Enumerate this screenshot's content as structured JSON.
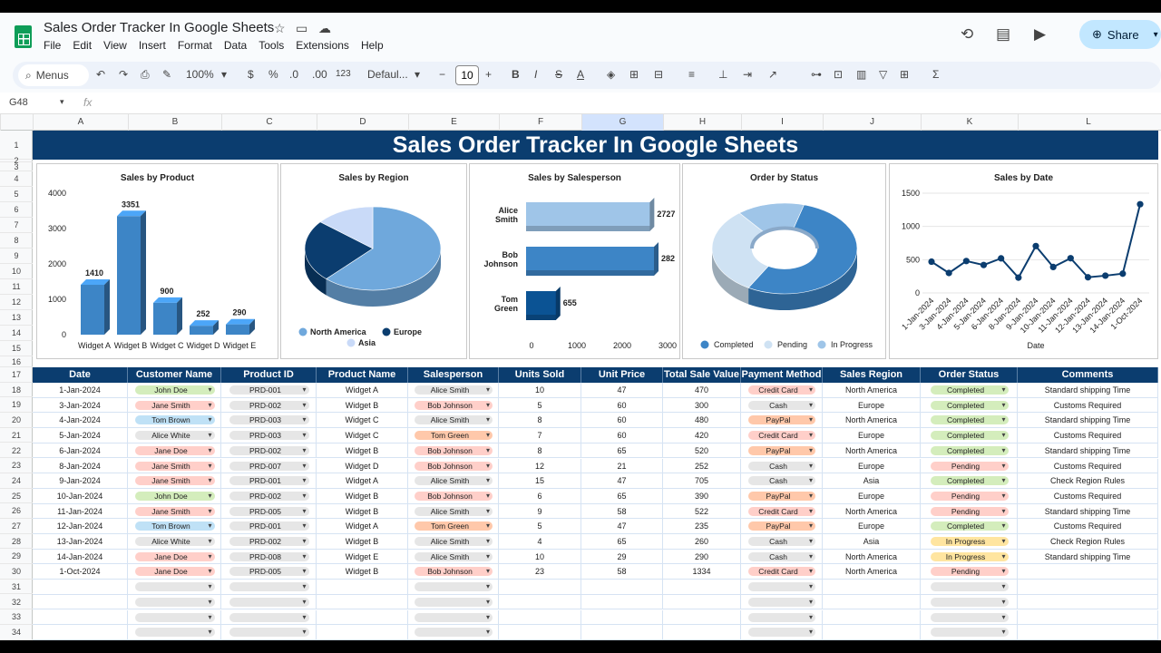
{
  "app": {
    "title": "Sales Order Tracker In Google Sheets",
    "menu": [
      "File",
      "Edit",
      "View",
      "Insert",
      "Format",
      "Data",
      "Tools",
      "Extensions",
      "Help"
    ],
    "share_label": "Share"
  },
  "toolbar": {
    "search_label": "Menus",
    "zoom": "100%",
    "currency": "$",
    "percent": "%",
    "number_format": "123",
    "font": "Defaul...",
    "font_size": "10"
  },
  "formula_bar": {
    "cell_ref": "G48",
    "fx": "fx"
  },
  "columns": [
    "A",
    "B",
    "C",
    "D",
    "E",
    "F",
    "G",
    "H",
    "I",
    "J",
    "K",
    "L"
  ],
  "banner": "Sales Order Tracker In Google Sheets",
  "charts": {
    "product": {
      "title": "Sales by Product"
    },
    "region": {
      "title": "Sales by Region"
    },
    "salesperson": {
      "title": "Sales by Salesperson"
    },
    "status": {
      "title": "Order by Status"
    },
    "date": {
      "title": "Sales by Date"
    }
  },
  "chart_data": [
    {
      "type": "bar",
      "title": "Sales by Product",
      "categories": [
        "Widget A",
        "Widget B",
        "Widget C",
        "Widget D",
        "Widget E"
      ],
      "values": [
        1410,
        3351,
        900,
        252,
        290
      ],
      "ylim": [
        0,
        4000
      ],
      "yticks": [
        "0",
        "1000",
        "2000",
        "3000",
        "4000"
      ],
      "color": "#3d85c6"
    },
    {
      "type": "pie",
      "title": "Sales by Region",
      "labels": [
        "North America",
        "Europe",
        "Asia"
      ],
      "values": [
        62,
        24,
        14
      ],
      "colors": [
        "#6fa8dc",
        "#0b3d6f",
        "#c9daf8"
      ]
    },
    {
      "type": "bar",
      "title": "Sales by Salesperson",
      "orientation": "horizontal",
      "categories": [
        "Alice Smith",
        "Bob Johnson",
        "Tom Green"
      ],
      "values": [
        2727,
        2820,
        655
      ],
      "value_labels": [
        "2727",
        "282",
        "655"
      ],
      "xlim": [
        0,
        3000
      ],
      "xticks": [
        "0",
        "1000",
        "2000",
        "3000"
      ],
      "colors": [
        "#9fc5e8",
        "#3d85c6",
        "#0b5394"
      ]
    },
    {
      "type": "pie",
      "title": "Order by Status",
      "donut": true,
      "labels": [
        "Completed",
        "Pending",
        "In Progress"
      ],
      "values": [
        54,
        31,
        15
      ],
      "colors": [
        "#3d85c6",
        "#cfe2f3",
        "#9fc5e8"
      ]
    },
    {
      "type": "line",
      "title": "Sales by Date",
      "xlabel": "Date",
      "x": [
        "1-Jan-2024",
        "3-Jan-2024",
        "4-Jan-2024",
        "5-Jan-2024",
        "6-Jan-2024",
        "8-Jan-2024",
        "9-Jan-2024",
        "10-Jan-2024",
        "11-Jan-2024",
        "12-Jan-2024",
        "13-Jan-2024",
        "14-Jan-2024",
        "1-Oct-2024"
      ],
      "y": [
        470,
        300,
        480,
        420,
        520,
        230,
        705,
        390,
        522,
        235,
        260,
        290,
        1334
      ],
      "ylim": [
        0,
        1500
      ],
      "yticks": [
        "0",
        "500",
        "1000",
        "1500"
      ],
      "color": "#0b3d6f"
    }
  ],
  "table": {
    "headers": [
      "Date",
      "Customer Name",
      "Product ID",
      "Product Name",
      "Salesperson",
      "Units Sold",
      "Unit Price",
      "Total Sale Value",
      "Payment Method",
      "Sales Region",
      "Order Status",
      "Comments"
    ],
    "rows": [
      [
        "1-Jan-2024",
        "John Doe",
        "PRD-001",
        "Widget A",
        "Alice Smith",
        "10",
        "47",
        "470",
        "Credit Card",
        "North America",
        "Completed",
        "Standard shipping Time"
      ],
      [
        "3-Jan-2024",
        "Jane Smith",
        "PRD-002",
        "Widget B",
        "Bob Johnson",
        "5",
        "60",
        "300",
        "Cash",
        "Europe",
        "Completed",
        "Customs Required"
      ],
      [
        "4-Jan-2024",
        "Tom Brown",
        "PRD-003",
        "Widget C",
        "Alice Smith",
        "8",
        "60",
        "480",
        "PayPal",
        "North America",
        "Completed",
        "Standard shipping Time"
      ],
      [
        "5-Jan-2024",
        "Alice White",
        "PRD-003",
        "Widget C",
        "Tom Green",
        "7",
        "60",
        "420",
        "Credit Card",
        "Europe",
        "Completed",
        "Customs Required"
      ],
      [
        "6-Jan-2024",
        "Jane Doe",
        "PRD-002",
        "Widget B",
        "Bob Johnson",
        "8",
        "65",
        "520",
        "PayPal",
        "North America",
        "Completed",
        "Standard shipping Time"
      ],
      [
        "8-Jan-2024",
        "Jane Smith",
        "PRD-007",
        "Widget D",
        "Bob Johnson",
        "12",
        "21",
        "252",
        "Cash",
        "Europe",
        "Pending",
        "Customs Required"
      ],
      [
        "9-Jan-2024",
        "Jane Smith",
        "PRD-001",
        "Widget A",
        "Alice Smith",
        "15",
        "47",
        "705",
        "Cash",
        "Asia",
        "Completed",
        "Check Region Rules"
      ],
      [
        "10-Jan-2024",
        "John Doe",
        "PRD-002",
        "Widget B",
        "Bob Johnson",
        "6",
        "65",
        "390",
        "PayPal",
        "Europe",
        "Pending",
        "Customs Required"
      ],
      [
        "11-Jan-2024",
        "Jane Smith",
        "PRD-005",
        "Widget B",
        "Alice Smith",
        "9",
        "58",
        "522",
        "Credit Card",
        "North America",
        "Pending",
        "Standard shipping Time"
      ],
      [
        "12-Jan-2024",
        "Tom Brown",
        "PRD-001",
        "Widget A",
        "Tom Green",
        "5",
        "47",
        "235",
        "PayPal",
        "Europe",
        "Completed",
        "Customs Required"
      ],
      [
        "13-Jan-2024",
        "Alice White",
        "PRD-002",
        "Widget B",
        "Alice Smith",
        "4",
        "65",
        "260",
        "Cash",
        "Asia",
        "In Progress",
        "Check Region Rules"
      ],
      [
        "14-Jan-2024",
        "Jane Doe",
        "PRD-008",
        "Widget E",
        "Alice Smith",
        "10",
        "29",
        "290",
        "Cash",
        "North America",
        "In Progress",
        "Standard shipping Time"
      ],
      [
        "1-Oct-2024",
        "Jane Doe",
        "PRD-005",
        "Widget B",
        "Bob Johnson",
        "23",
        "58",
        "1334",
        "Credit Card",
        "North America",
        "Pending",
        ""
      ]
    ]
  },
  "chip_colors": {
    "John Doe": "#d4edbc",
    "Jane Smith": "#ffcfc9",
    "Tom Brown": "#bfe1f6",
    "Alice White": "#e6e6e6",
    "Jane Doe": "#ffcfc9",
    "Alice Smith": "#e6e6e6",
    "Bob Johnson": "#ffcfc9",
    "Tom Green": "#ffc8aa",
    "Credit Card": "#ffcfc9",
    "Cash": "#e6e6e6",
    "PayPal": "#ffc8aa",
    "Completed": "#d4edbc",
    "Pending": "#ffcfc9",
    "In Progress": "#ffe5a0",
    "default": "#e6e6e6"
  }
}
